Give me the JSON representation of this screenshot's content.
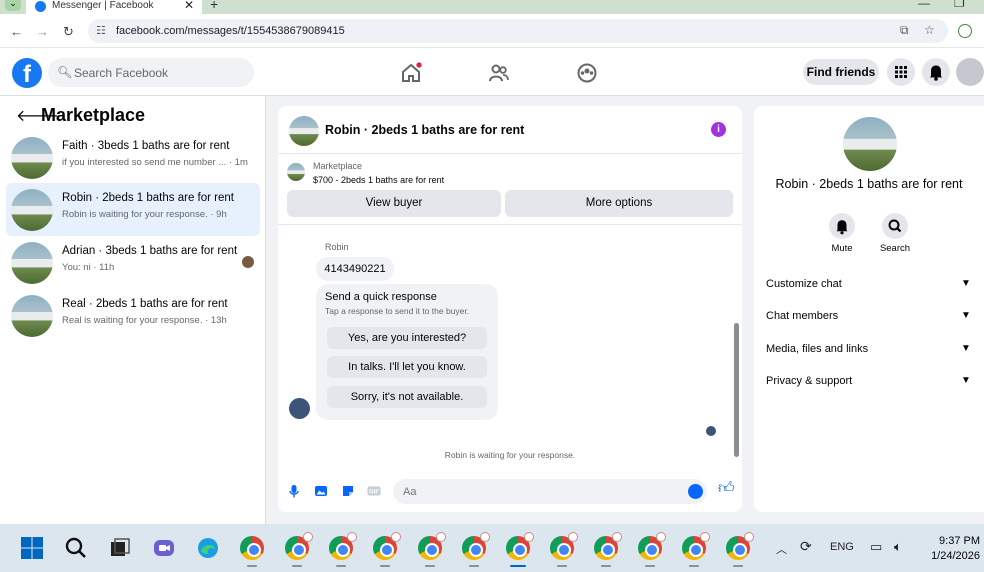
{
  "browser": {
    "tab_title": "Messenger | Facebook",
    "url": "facebook.com/messages/t/1554538679089415"
  },
  "fb_nav": {
    "logo": "f",
    "search_placeholder": "Search Facebook",
    "find_friends": "Find friends"
  },
  "sidebar": {
    "title": "Marketplace",
    "conversations": [
      {
        "title": "Faith · 3beds 1 baths are for rent",
        "preview": "if you interested so send me number ... · 1m",
        "active": false
      },
      {
        "title": "Robin · 2beds 1 baths are for rent",
        "preview": "Robin is waiting for your response. · 9h",
        "active": true
      },
      {
        "title": "Adrian · 3beds 1 baths are for rent",
        "preview": "You: ni · 11h",
        "active": false
      },
      {
        "title": "Real · 2beds 1 baths are for rent",
        "preview": "Real is waiting for your response. · 13h",
        "active": false
      }
    ]
  },
  "chat": {
    "title": "Robin · 2beds 1 baths are for rent",
    "listing_label": "Marketplace",
    "listing_price": "$700 - 2beds 1 baths are for rent",
    "view_buyer": "View buyer",
    "more_options": "More options",
    "sender_name": "Robin",
    "message_text": "4143490221",
    "quick_response_title": "Send a quick response",
    "quick_response_sub": "Tap a response to send it to the buyer.",
    "quick_responses": [
      "Yes, are you interested?",
      "In talks. I'll let you know.",
      "Sorry, it's not available."
    ],
    "waiting_text": "Robin is waiting for your response.",
    "input_placeholder": "Aa"
  },
  "right_panel": {
    "name": "Robin · 2beds 1 baths are for rent",
    "mute": "Mute",
    "search": "Search",
    "sections": [
      "Customize chat",
      "Chat members",
      "Media, files and links",
      "Privacy & support"
    ]
  },
  "taskbar": {
    "language": "ENG",
    "time": "9:37 PM",
    "date": "1/24/2026"
  },
  "colors": {
    "facebook_blue": "#1877f2",
    "messenger_blue": "#0866ff",
    "info_purple": "#a033e0",
    "active_row": "#e7f0fd"
  }
}
